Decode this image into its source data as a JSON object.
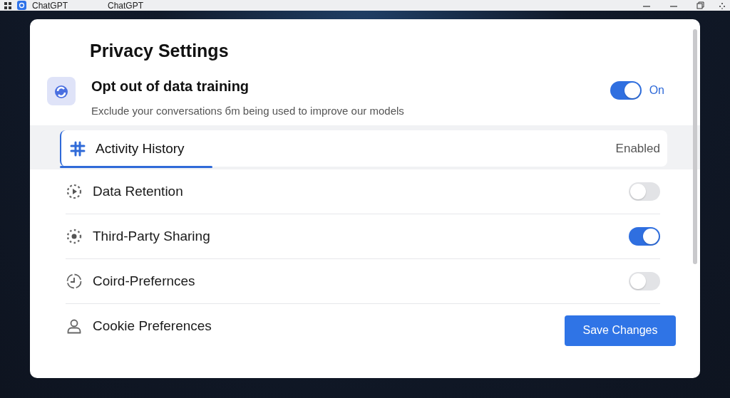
{
  "titlebar": {
    "app_name": "ChatGPT",
    "tab_title": "ChatGPT"
  },
  "title": "Privacy Settings",
  "opt_out": {
    "title": "Opt out of data training",
    "description": "Exclude your conversations бm being used to improve our models",
    "on": true,
    "state_label": "On"
  },
  "activity": {
    "label": "Activity History",
    "status": "Enabled",
    "selected": true
  },
  "settings": [
    {
      "label": "Data Retention",
      "kind": "toggle",
      "on": false
    },
    {
      "label": "Third-Party Sharing",
      "kind": "toggle",
      "on": true
    },
    {
      "label": "Coird-Prefernces",
      "kind": "toggle",
      "on": false
    },
    {
      "label": "Cookie Preferences",
      "kind": "plain"
    }
  ],
  "save_button": "Save Changes"
}
